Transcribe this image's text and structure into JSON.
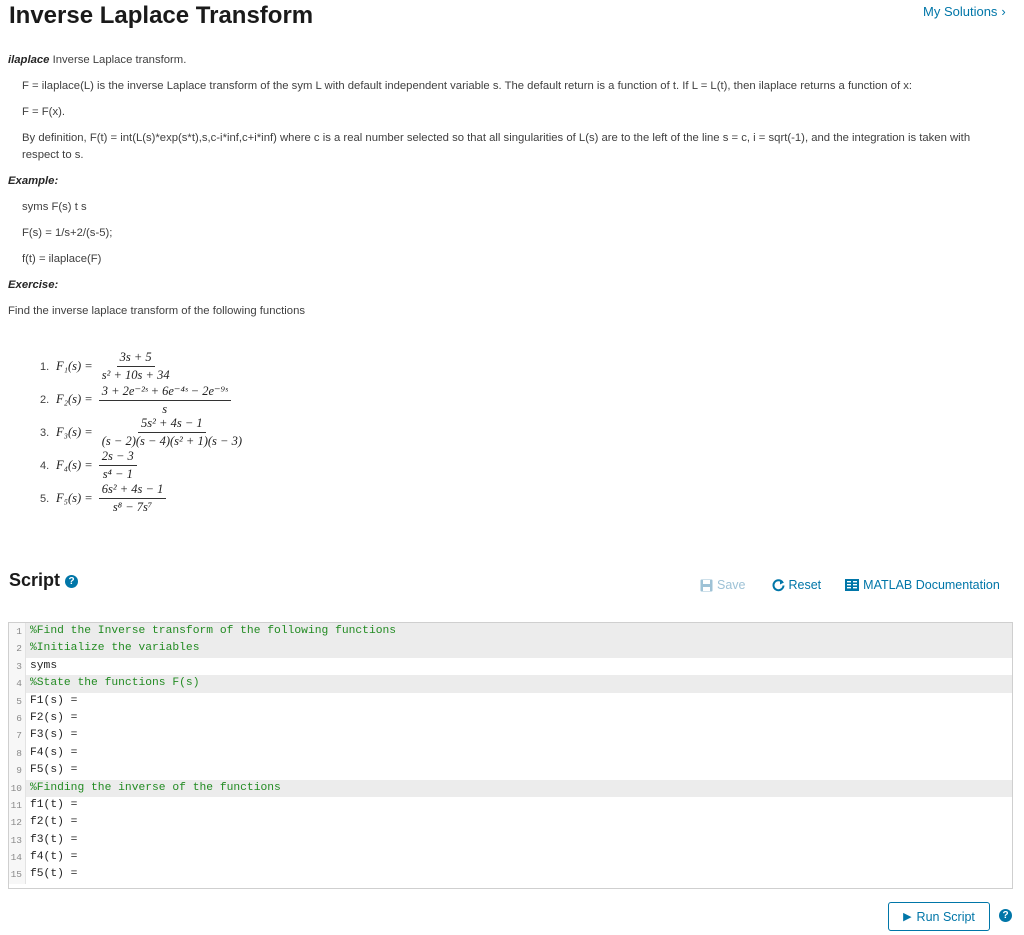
{
  "page": {
    "title": "Inverse Laplace Transform",
    "my_solutions": "My Solutions",
    "my_solutions_chevron": "›"
  },
  "description": {
    "func_name": "ilaplace",
    "func_summary": " Inverse Laplace transform.",
    "p1": "F = ilaplace(L) is the inverse Laplace transform of the sym L with default independent variable s.  The default return is a function of t.  If L = L(t), then ilaplace returns a function of x:",
    "p2": "F = F(x).",
    "p3": "By definition, F(t) = int(L(s)*exp(s*t),s,c-i*inf,c+i*inf)  where c is a real number selected so that all singularities of L(s) are to the left of the line s = c, i = sqrt(-1), and the integration is taken with respect to s.",
    "example_heading": "Example:",
    "example_lines": [
      "syms F(s) t s",
      "F(s) = 1/s+2/(s-5);",
      "f(t) = ilaplace(F)"
    ],
    "exercise_heading": "Exercise:",
    "exercise_intro": "Find the inverse laplace transform of the following functions"
  },
  "exercises": [
    {
      "num": "1.",
      "lhs": "F₁(s) =",
      "numerator": "3s + 5",
      "denominator": "s² + 10s + 34"
    },
    {
      "num": "2.",
      "lhs": "F₂(s) =",
      "numerator": "3 + 2e⁻²ˢ + 6e⁻⁴ˢ − 2e⁻⁹ˢ",
      "denominator": "s"
    },
    {
      "num": "3.",
      "lhs": "F₃(s) =",
      "numerator": "5s² + 4s − 1",
      "denominator": "(s − 2)(s − 4)(s² + 1)(s − 3)"
    },
    {
      "num": "4.",
      "lhs": "F₄(s) =",
      "numerator": "2s − 3",
      "denominator": "s⁴ − 1"
    },
    {
      "num": "5.",
      "lhs": "F₅(s) =",
      "numerator": "6s² + 4s − 1",
      "denominator": "s⁸ − 7s⁷"
    }
  ],
  "script": {
    "title": "Script",
    "help_glyph": "?",
    "save_label": "Save",
    "reset_label": "Reset",
    "doc_label": "MATLAB Documentation",
    "run_label": "Run Script",
    "run_glyph": "▶"
  },
  "code_lines": [
    {
      "n": "1",
      "text": "%Find the Inverse transform of the following functions",
      "comment": true,
      "readonly": true
    },
    {
      "n": "2",
      "text": "%Initialize the variables",
      "comment": true,
      "readonly": true
    },
    {
      "n": "3",
      "text": "syms",
      "comment": false,
      "readonly": false
    },
    {
      "n": "4",
      "text": "%State the functions F(s)",
      "comment": true,
      "readonly": true
    },
    {
      "n": "5",
      "text": "F1(s) =",
      "comment": false,
      "readonly": false
    },
    {
      "n": "6",
      "text": "F2(s) =",
      "comment": false,
      "readonly": false
    },
    {
      "n": "7",
      "text": "F3(s) =",
      "comment": false,
      "readonly": false
    },
    {
      "n": "8",
      "text": "F4(s) =",
      "comment": false,
      "readonly": false
    },
    {
      "n": "9",
      "text": "F5(s) =",
      "comment": false,
      "readonly": false
    },
    {
      "n": "10",
      "text": "%Finding the inverse of the functions",
      "comment": true,
      "readonly": true
    },
    {
      "n": "11",
      "text": "f1(t) =",
      "comment": false,
      "readonly": false
    },
    {
      "n": "12",
      "text": "f2(t) =",
      "comment": false,
      "readonly": false
    },
    {
      "n": "13",
      "text": "f3(t) =",
      "comment": false,
      "readonly": false
    },
    {
      "n": "14",
      "text": "f4(t) =",
      "comment": false,
      "readonly": false
    },
    {
      "n": "15",
      "text": "f5(t) =",
      "comment": false,
      "readonly": false
    }
  ],
  "colors": {
    "accent": "#0076a8",
    "comment": "#228b22",
    "disabled": "#9ec2d6"
  }
}
